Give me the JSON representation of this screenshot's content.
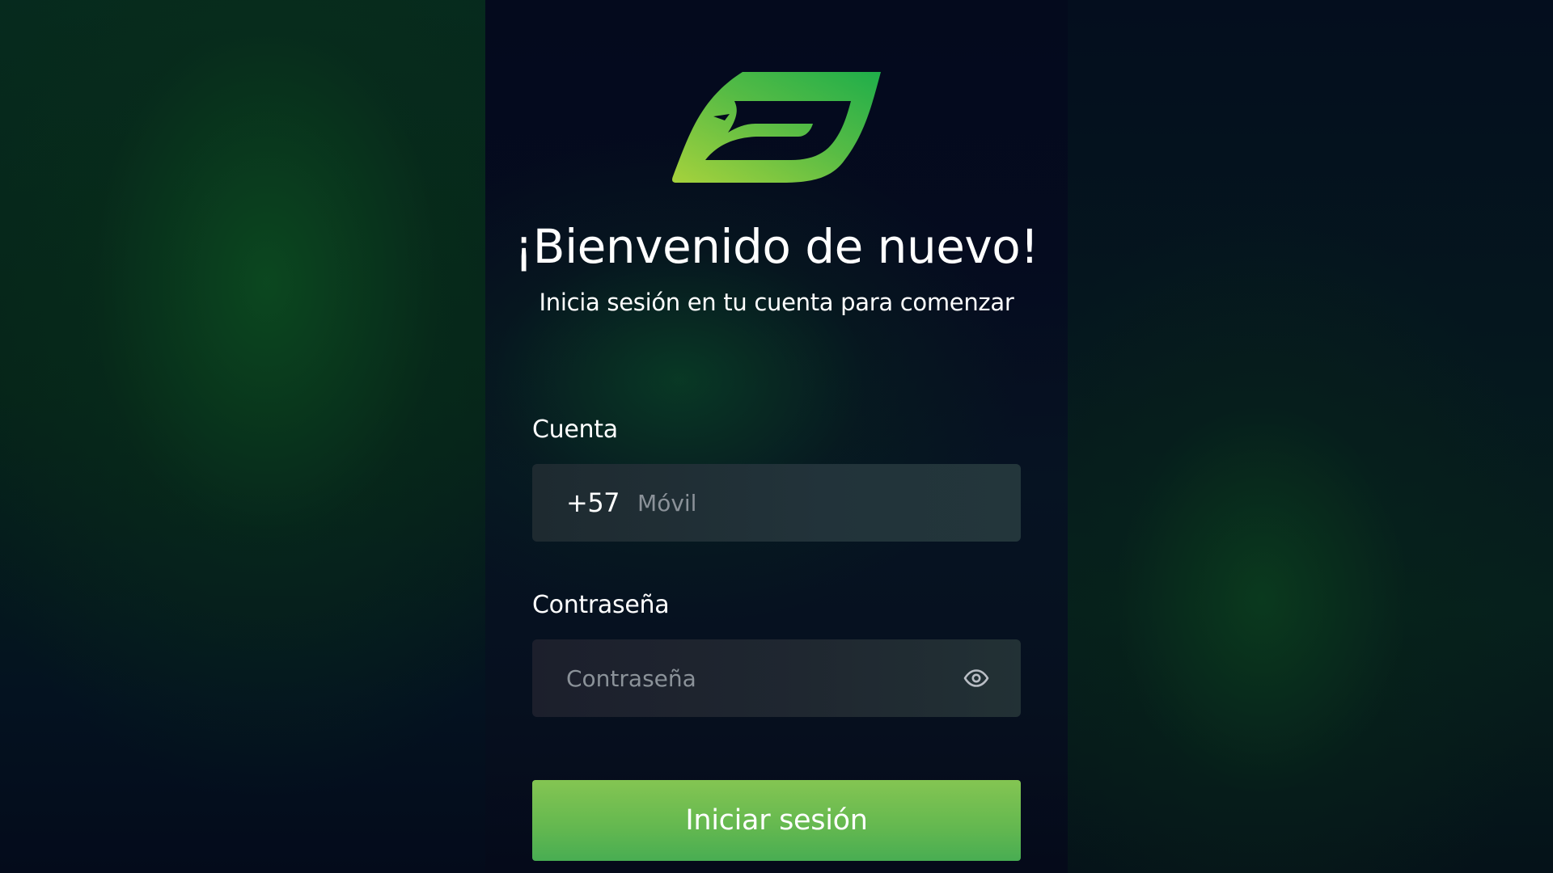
{
  "brand": {
    "logo_icon": "leaf-logo-icon",
    "gradient_start": "#a6d23c",
    "gradient_end": "#1fae4a"
  },
  "header": {
    "title": "¡Bienvenido de nuevo!",
    "subtitle": "Inicia sesión en tu cuenta para comenzar"
  },
  "form": {
    "account": {
      "label": "Cuenta",
      "country_code": "+57",
      "value": "",
      "placeholder": "Móvil"
    },
    "password": {
      "label": "Contraseña",
      "value": "",
      "placeholder": "Contraseña",
      "toggle_icon": "eye-icon"
    },
    "submit_label": "Iniciar sesión"
  },
  "colors": {
    "button_gradient_top": "#84c552",
    "button_gradient_bottom": "#48ad52",
    "placeholder": "#8b9299",
    "background_dark": "#050a1a",
    "background_green": "#0c4620"
  }
}
